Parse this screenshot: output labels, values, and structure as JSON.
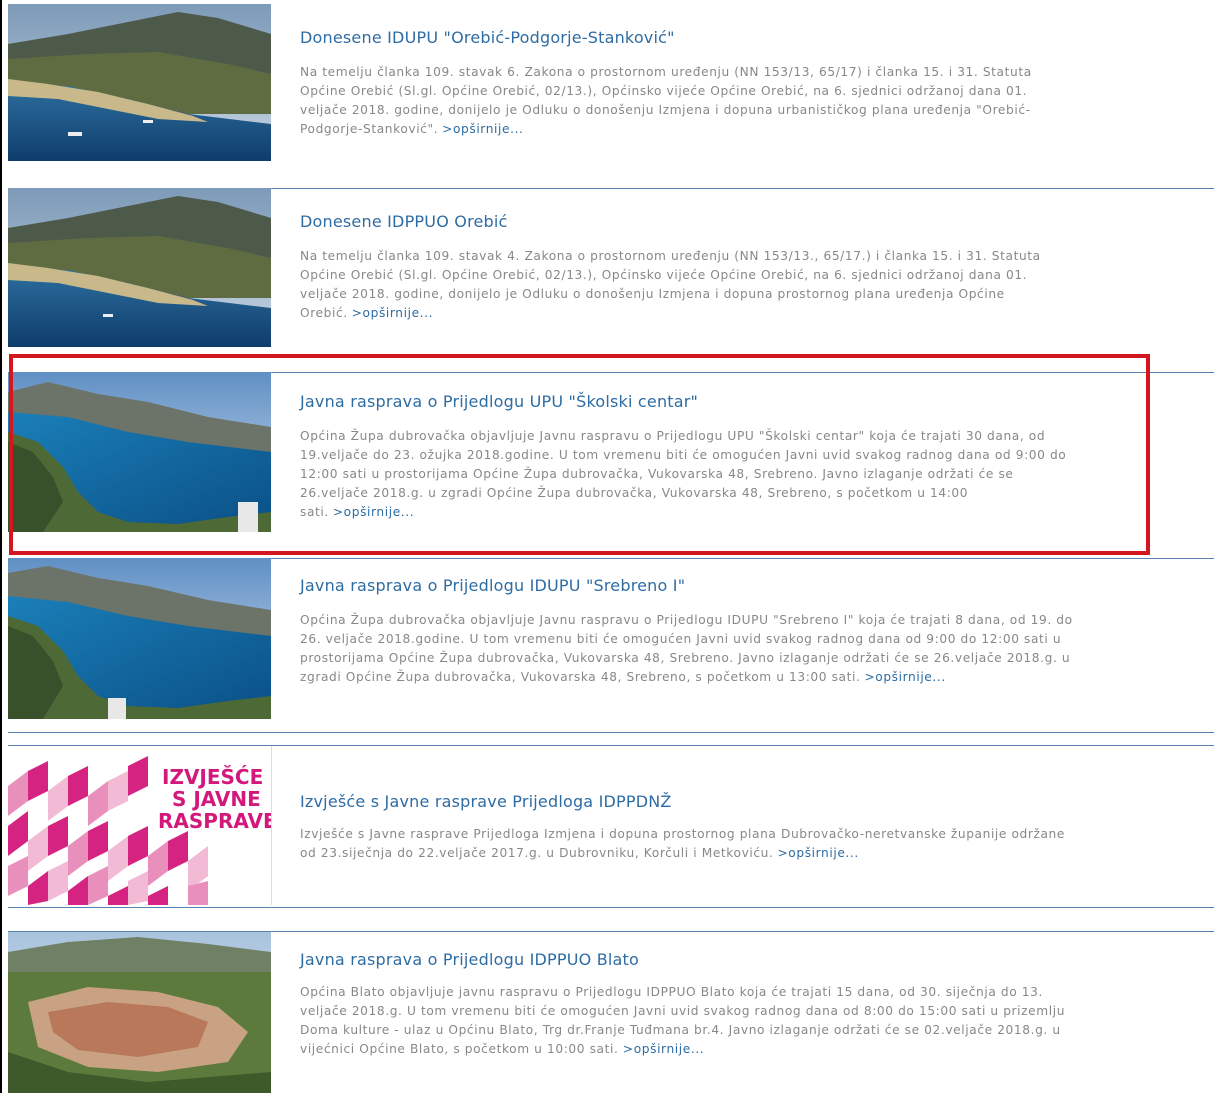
{
  "items": [
    {
      "title": "Donesene IDUPU \"Orebić-Podgorje-Stanković\"",
      "body": "Na temelju članka 109. stavak 6. Zakona o prostornom uređenju (NN 153/13, 65/17) i članka 15. i 31. Statuta Općine Orebić (Sl.gl. Općine Orebić, 02/13.), Općinsko vijeće Općine Orebić, na 6. sjednici održanoj dana 01. veljače 2018. godine, donijelo je Odluku o donošenju Izmjena i dopuna urbanističkog plana uređenja \"Orebić-Podgorje-Stanković\".",
      "more": ">opširnije..."
    },
    {
      "title": "Donesene IDPPUO Orebić",
      "body": "Na temelju članka 109. stavak 4. Zakona o prostornom uređenju (NN 153/13., 65/17.) i članka 15. i 31. Statuta Općine Orebić (Sl.gl. Općine Orebić, 02/13.), Općinsko vijeće Općine Orebić, na 6. sjednici održanoj dana 01. veljače 2018. godine, donijelo je Odluku o donošenju Izmjena i dopuna prostornog plana uređenja Općine Orebić.",
      "more": ">opširnije..."
    },
    {
      "title": "Javna rasprava o Prijedlogu UPU \"Školski centar\"",
      "body": "Općina Župa dubrovačka objavljuje Javnu raspravu o Prijedlogu UPU \"Školski centar\" koja će trajati 30 dana, od 19.veljače do 23. ožujka 2018.godine. U tom vremenu biti će omogućen Javni uvid svakog radnog dana od 9:00 do 12:00 sati u prostorijama Općine Župa dubrovačka, Vukovarska 48, Srebreno. Javno izlaganje održati će se 26.veljače 2018.g. u zgradi Općine Župa dubrovačka, Vukovarska 48, Srebreno, s početkom u 14:00 sati.",
      "more": ">opširnije..."
    },
    {
      "title": "Javna rasprava o Prijedlogu IDUPU \"Srebreno I\"",
      "body": "Općina Župa dubrovačka objavljuje Javnu raspravu o Prijedlogu IDUPU \"Srebreno I\" koja će trajati 8 dana, od 19. do 26. veljače 2018.godine. U tom vremenu biti će omogućen Javni uvid svakog radnog dana od 9:00 do 12:00 sati u prostorijama Općine Župa dubrovačka, Vukovarska 48, Srebreno. Javno izlaganje održati će se 26.veljače 2018.g. u zgradi Općine Župa dubrovačka, Vukovarska 48, Srebreno, s početkom u 13:00 sati.",
      "more": ">opširnije..."
    },
    {
      "title": "Izvješće s Javne rasprave Prijedloga IDPPDNŽ",
      "body": "Izvješće s Javne rasprave Prijedloga Izmjena i dopuna prostornog plana Dubrovačko-neretvanske županije održane od 23.siječnja do 22.veljače 2017.g. u Dubrovniku, Korčuli i Metkoviću.",
      "more": ">opširnije..."
    },
    {
      "title": "Javna rasprava o Prijedlogu IDPPUO Blato",
      "body": "Općina Blato objavljuje javnu raspravu o Prijedlogu IDPPUO Blato koja će trajati 15 dana, od 30. siječnja do 13. veljače 2018.g. U tom vremenu biti će omogućen Javni uvid svakog radnog dana od 8:00 do 15:00 sati u prizemlju Doma kulture - ulaz u Općinu Blato, Trg dr.Franje Tuđmana br.4. Javno izlaganje održati će se 02.veljače 2018.g. u vijećnici Općine Blato, s početkom u 10:00 sati.",
      "more": ">opširnije..."
    }
  ],
  "logo": {
    "line1": "IZVJEŠĆE",
    "line2": "S JAVNE",
    "line3": "RASPRAVE"
  },
  "colors": {
    "link": "#2e6ca4",
    "body_text": "#888888",
    "divider": "#5a84b0",
    "highlight": "#d4161f",
    "logo_pink": "#d3187c"
  }
}
